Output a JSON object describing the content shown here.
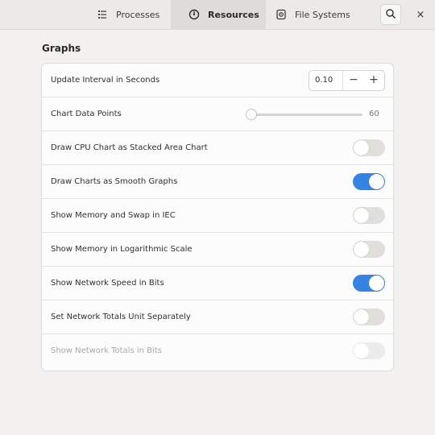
{
  "header": {
    "tabs": [
      {
        "label": "Processes",
        "icon": "list-icon"
      },
      {
        "label": "Resources",
        "icon": "gauge-icon",
        "selected": true
      },
      {
        "label": "File Systems",
        "icon": "disk-icon"
      }
    ],
    "search_icon": "search-icon",
    "close_glyph": "×"
  },
  "section": {
    "title": "Graphs"
  },
  "settings": {
    "update_interval": {
      "label": "Update Interval in Seconds",
      "value": "0.10",
      "minus": "−",
      "plus": "+"
    },
    "chart_points": {
      "label": "Chart Data Points",
      "value": "60"
    },
    "stacked_area": {
      "label": "Draw CPU Chart as Stacked Area Chart",
      "on": false
    },
    "smooth_graphs": {
      "label": "Draw Charts as Smooth Graphs",
      "on": true
    },
    "memory_iec": {
      "label": "Show Memory and Swap in IEC",
      "on": false
    },
    "memory_log": {
      "label": "Show Memory in Logarithmic Scale",
      "on": false
    },
    "network_bits": {
      "label": "Show Network Speed in Bits",
      "on": true
    },
    "network_totals_unit": {
      "label": "Set Network Totals Unit Separately",
      "on": false
    },
    "network_totals_bits": {
      "label": "Show Network Totals in Bits",
      "on": false,
      "disabled": true
    }
  },
  "colors": {
    "accent": "#3584e4",
    "background": "#f2f1ef",
    "card": "#fcfcfc"
  }
}
